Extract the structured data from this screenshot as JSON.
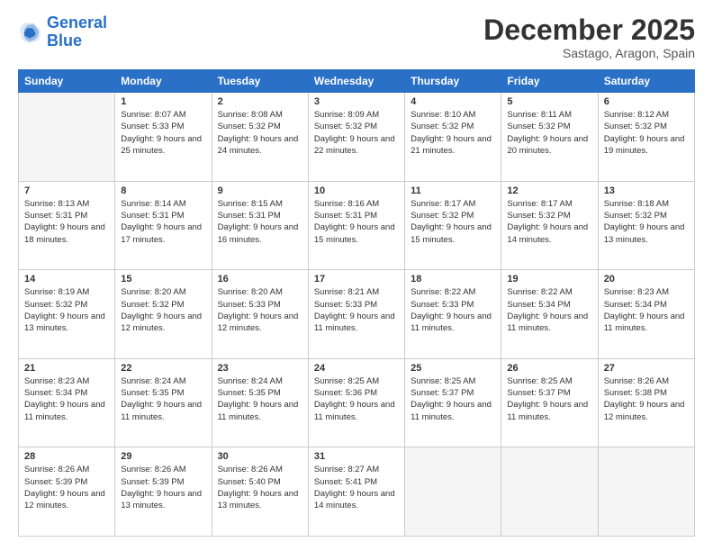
{
  "logo": {
    "line1": "General",
    "line2": "Blue"
  },
  "header": {
    "title": "December 2025",
    "subtitle": "Sastago, Aragon, Spain"
  },
  "weekdays": [
    "Sunday",
    "Monday",
    "Tuesday",
    "Wednesday",
    "Thursday",
    "Friday",
    "Saturday"
  ],
  "weeks": [
    [
      {
        "day": "",
        "sunrise": "",
        "sunset": "",
        "daylight": "",
        "empty": true
      },
      {
        "day": "1",
        "sunrise": "Sunrise: 8:07 AM",
        "sunset": "Sunset: 5:33 PM",
        "daylight": "Daylight: 9 hours and 25 minutes."
      },
      {
        "day": "2",
        "sunrise": "Sunrise: 8:08 AM",
        "sunset": "Sunset: 5:32 PM",
        "daylight": "Daylight: 9 hours and 24 minutes."
      },
      {
        "day": "3",
        "sunrise": "Sunrise: 8:09 AM",
        "sunset": "Sunset: 5:32 PM",
        "daylight": "Daylight: 9 hours and 22 minutes."
      },
      {
        "day": "4",
        "sunrise": "Sunrise: 8:10 AM",
        "sunset": "Sunset: 5:32 PM",
        "daylight": "Daylight: 9 hours and 21 minutes."
      },
      {
        "day": "5",
        "sunrise": "Sunrise: 8:11 AM",
        "sunset": "Sunset: 5:32 PM",
        "daylight": "Daylight: 9 hours and 20 minutes."
      },
      {
        "day": "6",
        "sunrise": "Sunrise: 8:12 AM",
        "sunset": "Sunset: 5:32 PM",
        "daylight": "Daylight: 9 hours and 19 minutes."
      }
    ],
    [
      {
        "day": "7",
        "sunrise": "Sunrise: 8:13 AM",
        "sunset": "Sunset: 5:31 PM",
        "daylight": "Daylight: 9 hours and 18 minutes."
      },
      {
        "day": "8",
        "sunrise": "Sunrise: 8:14 AM",
        "sunset": "Sunset: 5:31 PM",
        "daylight": "Daylight: 9 hours and 17 minutes."
      },
      {
        "day": "9",
        "sunrise": "Sunrise: 8:15 AM",
        "sunset": "Sunset: 5:31 PM",
        "daylight": "Daylight: 9 hours and 16 minutes."
      },
      {
        "day": "10",
        "sunrise": "Sunrise: 8:16 AM",
        "sunset": "Sunset: 5:31 PM",
        "daylight": "Daylight: 9 hours and 15 minutes."
      },
      {
        "day": "11",
        "sunrise": "Sunrise: 8:17 AM",
        "sunset": "Sunset: 5:32 PM",
        "daylight": "Daylight: 9 hours and 15 minutes."
      },
      {
        "day": "12",
        "sunrise": "Sunrise: 8:17 AM",
        "sunset": "Sunset: 5:32 PM",
        "daylight": "Daylight: 9 hours and 14 minutes."
      },
      {
        "day": "13",
        "sunrise": "Sunrise: 8:18 AM",
        "sunset": "Sunset: 5:32 PM",
        "daylight": "Daylight: 9 hours and 13 minutes."
      }
    ],
    [
      {
        "day": "14",
        "sunrise": "Sunrise: 8:19 AM",
        "sunset": "Sunset: 5:32 PM",
        "daylight": "Daylight: 9 hours and 13 minutes."
      },
      {
        "day": "15",
        "sunrise": "Sunrise: 8:20 AM",
        "sunset": "Sunset: 5:32 PM",
        "daylight": "Daylight: 9 hours and 12 minutes."
      },
      {
        "day": "16",
        "sunrise": "Sunrise: 8:20 AM",
        "sunset": "Sunset: 5:33 PM",
        "daylight": "Daylight: 9 hours and 12 minutes."
      },
      {
        "day": "17",
        "sunrise": "Sunrise: 8:21 AM",
        "sunset": "Sunset: 5:33 PM",
        "daylight": "Daylight: 9 hours and 11 minutes."
      },
      {
        "day": "18",
        "sunrise": "Sunrise: 8:22 AM",
        "sunset": "Sunset: 5:33 PM",
        "daylight": "Daylight: 9 hours and 11 minutes."
      },
      {
        "day": "19",
        "sunrise": "Sunrise: 8:22 AM",
        "sunset": "Sunset: 5:34 PM",
        "daylight": "Daylight: 9 hours and 11 minutes."
      },
      {
        "day": "20",
        "sunrise": "Sunrise: 8:23 AM",
        "sunset": "Sunset: 5:34 PM",
        "daylight": "Daylight: 9 hours and 11 minutes."
      }
    ],
    [
      {
        "day": "21",
        "sunrise": "Sunrise: 8:23 AM",
        "sunset": "Sunset: 5:34 PM",
        "daylight": "Daylight: 9 hours and 11 minutes."
      },
      {
        "day": "22",
        "sunrise": "Sunrise: 8:24 AM",
        "sunset": "Sunset: 5:35 PM",
        "daylight": "Daylight: 9 hours and 11 minutes."
      },
      {
        "day": "23",
        "sunrise": "Sunrise: 8:24 AM",
        "sunset": "Sunset: 5:35 PM",
        "daylight": "Daylight: 9 hours and 11 minutes."
      },
      {
        "day": "24",
        "sunrise": "Sunrise: 8:25 AM",
        "sunset": "Sunset: 5:36 PM",
        "daylight": "Daylight: 9 hours and 11 minutes."
      },
      {
        "day": "25",
        "sunrise": "Sunrise: 8:25 AM",
        "sunset": "Sunset: 5:37 PM",
        "daylight": "Daylight: 9 hours and 11 minutes."
      },
      {
        "day": "26",
        "sunrise": "Sunrise: 8:25 AM",
        "sunset": "Sunset: 5:37 PM",
        "daylight": "Daylight: 9 hours and 11 minutes."
      },
      {
        "day": "27",
        "sunrise": "Sunrise: 8:26 AM",
        "sunset": "Sunset: 5:38 PM",
        "daylight": "Daylight: 9 hours and 12 minutes."
      }
    ],
    [
      {
        "day": "28",
        "sunrise": "Sunrise: 8:26 AM",
        "sunset": "Sunset: 5:39 PM",
        "daylight": "Daylight: 9 hours and 12 minutes."
      },
      {
        "day": "29",
        "sunrise": "Sunrise: 8:26 AM",
        "sunset": "Sunset: 5:39 PM",
        "daylight": "Daylight: 9 hours and 13 minutes."
      },
      {
        "day": "30",
        "sunrise": "Sunrise: 8:26 AM",
        "sunset": "Sunset: 5:40 PM",
        "daylight": "Daylight: 9 hours and 13 minutes."
      },
      {
        "day": "31",
        "sunrise": "Sunrise: 8:27 AM",
        "sunset": "Sunset: 5:41 PM",
        "daylight": "Daylight: 9 hours and 14 minutes."
      },
      {
        "day": "",
        "sunrise": "",
        "sunset": "",
        "daylight": "",
        "empty": true
      },
      {
        "day": "",
        "sunrise": "",
        "sunset": "",
        "daylight": "",
        "empty": true
      },
      {
        "day": "",
        "sunrise": "",
        "sunset": "",
        "daylight": "",
        "empty": true
      }
    ]
  ]
}
